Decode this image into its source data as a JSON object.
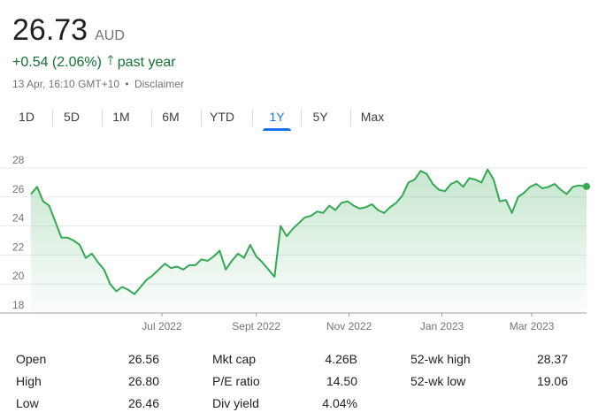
{
  "quote": {
    "price": "26.73",
    "currency": "AUD",
    "change": "+0.54 (2.06%)",
    "direction_icon": "arrow-up-icon",
    "period": "past year",
    "timestamp": "13 Apr, 16:10 GMT+10",
    "separator": "•",
    "disclaimer": "Disclaimer"
  },
  "tabs": [
    {
      "label": "1D",
      "active": false
    },
    {
      "label": "5D",
      "active": false
    },
    {
      "label": "1M",
      "active": false
    },
    {
      "label": "6M",
      "active": false
    },
    {
      "label": "YTD",
      "active": false
    },
    {
      "label": "1Y",
      "active": true
    },
    {
      "label": "5Y",
      "active": false
    },
    {
      "label": "Max",
      "active": false
    }
  ],
  "colors": {
    "line": "#34a853",
    "fill": "#e6f4ea",
    "positive": "#137333",
    "active_tab": "#1a73e8",
    "grid": "#e8eaed"
  },
  "chart_data": {
    "type": "area",
    "ylim": [
      18,
      28
    ],
    "y_ticks": [
      "18",
      "20",
      "22",
      "24",
      "26",
      "28"
    ],
    "x_tick_labels": [
      {
        "label": "Jul 2022",
        "day": 86
      },
      {
        "label": "Sept 2022",
        "day": 148
      },
      {
        "label": "Nov 2022",
        "day": 209
      },
      {
        "label": "Jan 2023",
        "day": 270
      },
      {
        "label": "Mar 2023",
        "day": 329
      }
    ],
    "x_range": [
      0,
      365
    ],
    "grid": true,
    "x": [
      0,
      4,
      8,
      12,
      16,
      20,
      24,
      28,
      32,
      36,
      40,
      44,
      48,
      52,
      56,
      60,
      64,
      68,
      72,
      76,
      80,
      84,
      88,
      92,
      96,
      100,
      104,
      108,
      112,
      116,
      120,
      124,
      128,
      132,
      136,
      140,
      144,
      148,
      152,
      156,
      160,
      164,
      168,
      172,
      176,
      180,
      184,
      188,
      192,
      196,
      200,
      204,
      208,
      212,
      216,
      220,
      224,
      228,
      232,
      236,
      240,
      244,
      248,
      252,
      256,
      260,
      264,
      268,
      272,
      276,
      280,
      284,
      288,
      292,
      296,
      300,
      304,
      308,
      312,
      316,
      320,
      324,
      328,
      332,
      336,
      340,
      344,
      348,
      352,
      356,
      360,
      365
    ],
    "values": [
      26.2,
      26.7,
      25.7,
      25.4,
      24.3,
      23.2,
      23.2,
      23.0,
      22.7,
      21.8,
      22.1,
      21.5,
      21.0,
      20.0,
      19.5,
      19.8,
      19.6,
      19.3,
      19.8,
      20.3,
      20.6,
      21.0,
      21.4,
      21.1,
      21.2,
      21.0,
      21.3,
      21.3,
      21.7,
      21.6,
      21.9,
      22.3,
      21.0,
      21.6,
      22.1,
      21.8,
      22.7,
      21.9,
      21.5,
      21.0,
      20.5,
      24.0,
      23.3,
      23.8,
      24.2,
      24.6,
      24.7,
      25.0,
      24.9,
      25.4,
      25.1,
      25.6,
      25.7,
      25.4,
      25.2,
      25.3,
      25.5,
      25.1,
      24.9,
      25.3,
      25.6,
      26.1,
      27.0,
      27.2,
      27.8,
      27.6,
      26.9,
      26.5,
      26.4,
      26.9,
      27.1,
      26.7,
      27.3,
      27.2,
      27.0,
      27.9,
      27.2,
      25.7,
      25.8,
      24.9,
      26.0,
      26.3,
      26.7,
      26.9,
      26.6,
      26.7,
      26.9,
      26.5,
      26.2,
      26.7,
      26.8,
      26.73
    ]
  },
  "stats": [
    [
      {
        "label": "Open",
        "value": "26.56"
      },
      {
        "label": "Mkt cap",
        "value": "4.26B"
      },
      {
        "label": "52-wk high",
        "value": "28.37"
      }
    ],
    [
      {
        "label": "High",
        "value": "26.80"
      },
      {
        "label": "P/E ratio",
        "value": "14.50"
      },
      {
        "label": "52-wk low",
        "value": "19.06"
      }
    ],
    [
      {
        "label": "Low",
        "value": "26.46"
      },
      {
        "label": "Div yield",
        "value": "4.04%"
      },
      {
        "label": "",
        "value": ""
      }
    ]
  ]
}
